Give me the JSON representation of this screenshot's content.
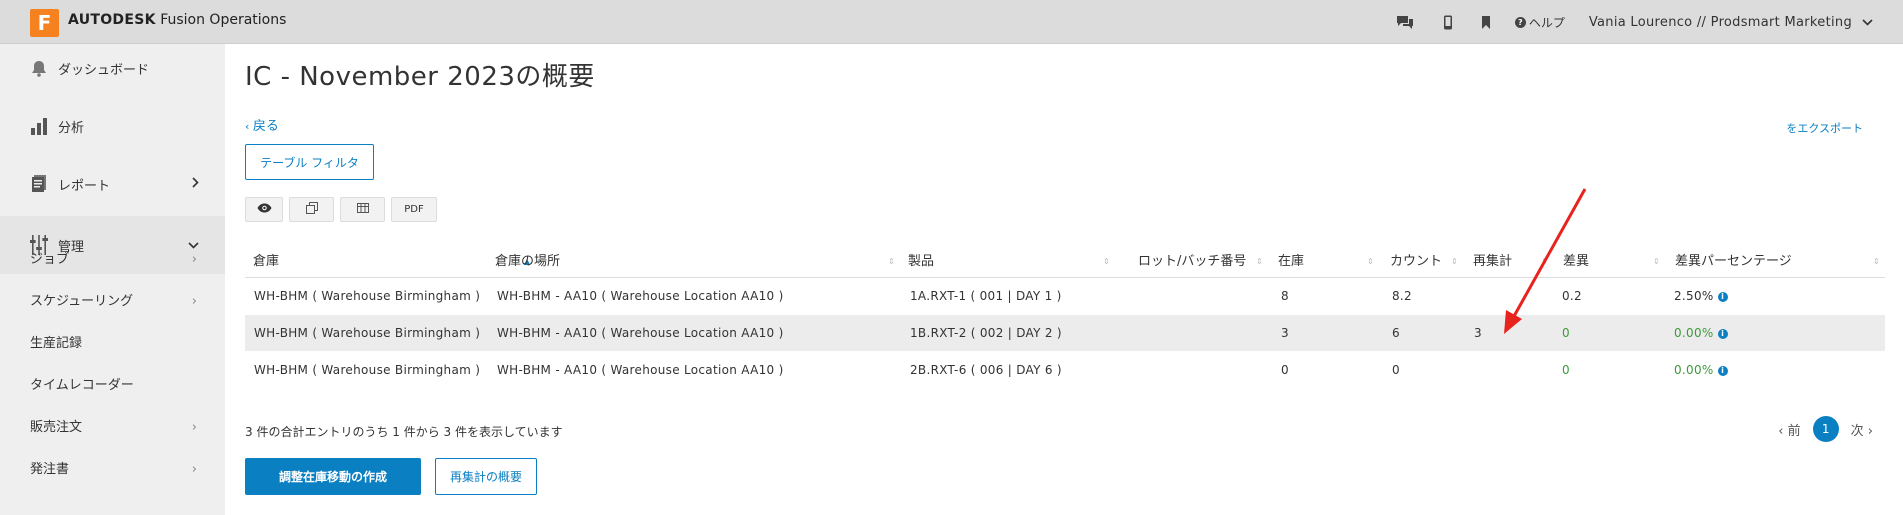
{
  "app": {
    "logo_letter": "F",
    "brand_bold": "AUTODESK",
    "brand_rest": " Fusion Operations",
    "help_label": "ヘルプ",
    "user_label": "Vania Lourenco // Prodsmart Marketing"
  },
  "sidebar": {
    "dashboard": "ダッシュボード",
    "analysis": "分析",
    "reports": "レポート",
    "admin": "管理",
    "sub_items": [
      {
        "label": "ジョブ",
        "has_arrow": true
      },
      {
        "label": "スケジューリング",
        "has_arrow": true
      },
      {
        "label": "生産記録",
        "has_arrow": false
      },
      {
        "label": "タイムレコーダー",
        "has_arrow": false
      },
      {
        "label": "販売注文",
        "has_arrow": true
      },
      {
        "label": "発注書",
        "has_arrow": true
      }
    ]
  },
  "main": {
    "title": "IC - November 2023の概要",
    "back": "戻る",
    "export": "をエクスポート",
    "filter_button": "テーブル フィルタ",
    "tool_pdf": "PDF",
    "columns": [
      "倉庫",
      "倉庫の場所",
      "製品",
      "ロット/バッチ番号",
      "在庫",
      "カウント",
      "再集計",
      "差異",
      "差異パーセンテージ"
    ],
    "rows": [
      {
        "warehouse": "WH-BHM ( Warehouse Birmingham )",
        "location": "WH-BHM - AA10 ( Warehouse Location AA10 )",
        "product": "1A.RXT-1 ( 001 | DAY 1 )",
        "lot": "",
        "stock": "8",
        "count": "8.2",
        "recount": "",
        "diff": "0.2",
        "pct": "2.50%"
      },
      {
        "warehouse": "WH-BHM ( Warehouse Birmingham )",
        "location": "WH-BHM - AA10 ( Warehouse Location AA10 )",
        "product": "1B.RXT-2 ( 002 | DAY 2 )",
        "lot": "",
        "stock": "3",
        "count": "6",
        "recount": "3",
        "diff": "0",
        "pct": "0.00%"
      },
      {
        "warehouse": "WH-BHM ( Warehouse Birmingham )",
        "location": "WH-BHM - AA10 ( Warehouse Location AA10 )",
        "product": "2B.RXT-6 ( 006 | DAY 6 )",
        "lot": "",
        "stock": "0",
        "count": "0",
        "recount": "",
        "diff": "0",
        "pct": "0.00%"
      }
    ],
    "entries_text": "3 件の合計エントリのうち 1 件から 3 件を表示しています",
    "pager": {
      "prev": "前",
      "current": "1",
      "next": "次"
    },
    "create_button": "調整在庫移動の作成",
    "recount_summary_button": "再集計の概要"
  },
  "colors": {
    "accent": "#0a7fc2",
    "brand_orange": "#f5821f",
    "positive": "#3c9a3c",
    "annotation": "#e8231d"
  }
}
